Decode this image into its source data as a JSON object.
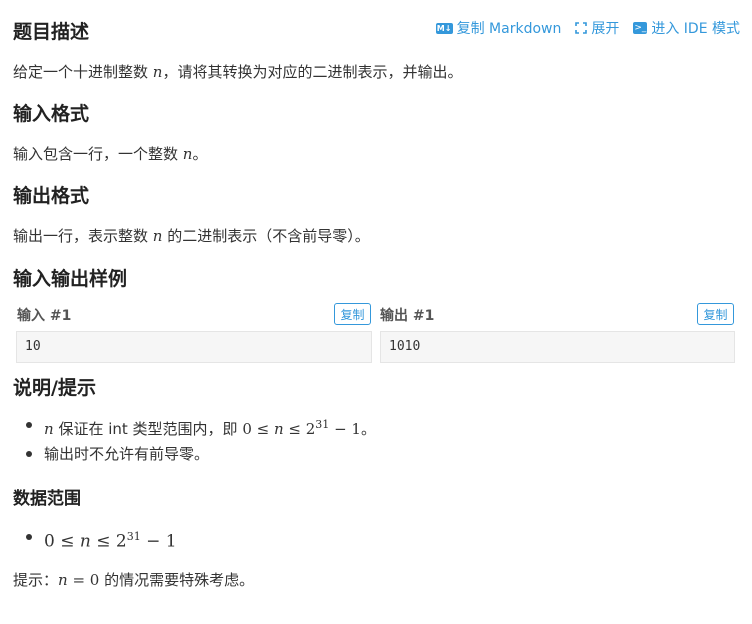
{
  "title": "题目描述",
  "toolbar": {
    "md_icon": "M↓",
    "copy_markdown": "复制 Markdown",
    "expand": "展开",
    "ide_icon": ">_",
    "enter_ide": "进入 IDE 模式"
  },
  "description": {
    "before": "给定一个十进制整数 ",
    "var": "n",
    "after": "，请将其转换为对应的二进制表示，并输出。"
  },
  "input_format": {
    "heading": "输入格式",
    "before": "输入包含一行，一个整数 ",
    "var": "n",
    "after": "。"
  },
  "output_format": {
    "heading": "输出格式",
    "before": "输出一行，表示整数 ",
    "var": "n",
    "after": " 的二进制表示（不含前导零）。"
  },
  "samples": {
    "heading": "输入输出样例",
    "input_label": "输入 #1",
    "output_label": "输出 #1",
    "copy_label": "复制",
    "input_value": "10",
    "output_value": "1010"
  },
  "hints": {
    "heading": "说明/提示",
    "item1": {
      "var": "n",
      "mid": " 保证在 int 类型范围内，即 ",
      "math_a": "0 ≤ ",
      "math_var": "n",
      "math_b": " ≤ 2",
      "exp": "31",
      "math_c": " − 1",
      "end": "。"
    },
    "item2": "输出时不允许有前导零。"
  },
  "range": {
    "heading": "数据范围",
    "math_a": "0 ≤ ",
    "math_var": "n",
    "math_b": " ≤ 2",
    "exp": "31",
    "math_c": " − 1"
  },
  "tip": {
    "prefix": "提示：",
    "var": "n",
    "eq": " = 0",
    "after": " 的情况需要特殊考虑。"
  }
}
